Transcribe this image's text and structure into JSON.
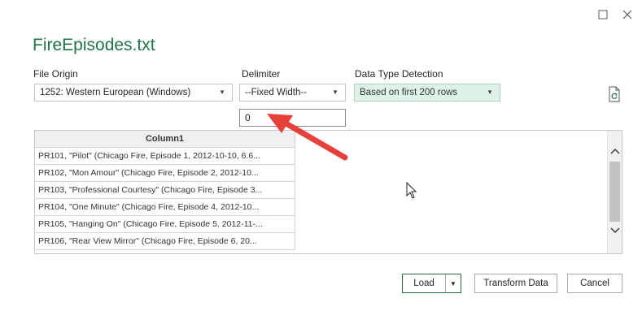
{
  "dialog": {
    "title": "FireEpisodes.txt"
  },
  "file_origin": {
    "label": "File Origin",
    "value": "1252: Western European (Windows)"
  },
  "delimiter": {
    "label": "Delimiter",
    "value": "--Fixed Width--"
  },
  "data_type_detection": {
    "label": "Data Type Detection",
    "value": "Based on first 200 rows"
  },
  "width_input": {
    "value": "0"
  },
  "preview": {
    "column_header": "Column1",
    "rows": [
      "PR101, \"Pilot\" (Chicago Fire, Episode 1, 2012-10-10, 6.6...",
      "PR102, \"Mon Amour\" (Chicago Fire, Episode 2, 2012-10...",
      "PR103, \"Professional Courtesy\" (Chicago Fire, Episode 3...",
      "PR104, \"One Minute\" (Chicago Fire, Episode 4, 2012-10...",
      "PR105, \"Hanging On\" (Chicago Fire, Episode 5, 2012-11-...",
      "PR106, \"Rear View Mirror\" (Chicago Fire, Episode 6, 20..."
    ]
  },
  "buttons": {
    "load": "Load",
    "transform": "Transform Data",
    "cancel": "Cancel"
  },
  "icons": {
    "maximize": "maximize-icon",
    "close": "close-icon",
    "refresh_file": "refresh-file-icon",
    "dropdown": "chevron-down-icon",
    "annotation": "red-arrow-annotation"
  },
  "colors": {
    "title_green": "#217346",
    "detection_bg": "#dff2e6",
    "arrow_red": "#e8413c"
  }
}
